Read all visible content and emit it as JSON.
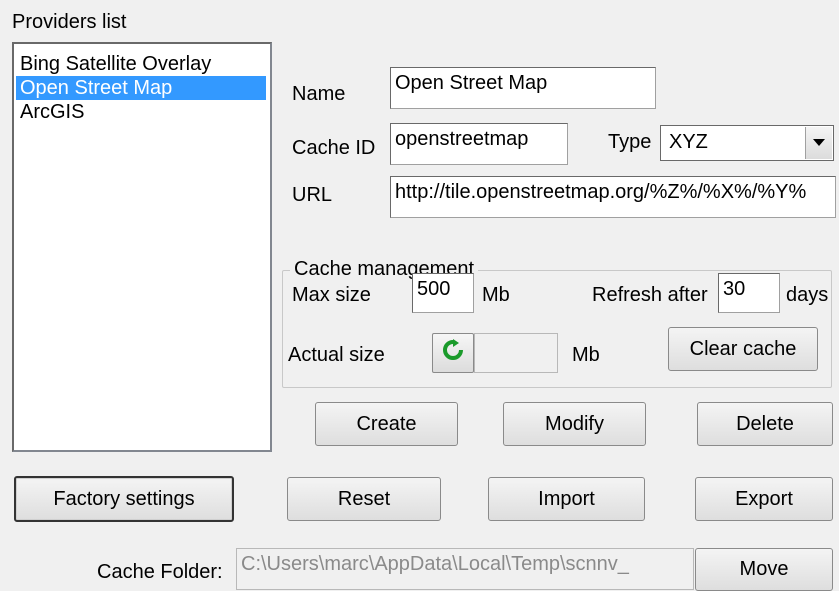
{
  "providers_list_label": "Providers list",
  "providers": [
    {
      "label": "Bing Satellite Overlay",
      "selected": false
    },
    {
      "label": "Open Street Map",
      "selected": true
    },
    {
      "label": "ArcGIS",
      "selected": false
    }
  ],
  "form": {
    "name_label": "Name",
    "name_value": "Open Street Map",
    "cache_id_label": "Cache ID",
    "cache_id_value": "openstreetmap",
    "type_label": "Type",
    "type_value": "XYZ",
    "url_label": "URL",
    "url_value": "http://tile.openstreetmap.org/%Z%/%X%/%Y%"
  },
  "cache_management": {
    "title": "Cache management",
    "max_size_label": "Max size",
    "max_size_value": "500",
    "max_size_unit": "Mb",
    "refresh_after_label": "Refresh after",
    "refresh_after_value": "30",
    "refresh_after_unit": "days",
    "actual_size_label": "Actual size",
    "actual_size_value": "",
    "actual_size_unit": "Mb",
    "clear_cache_label": "Clear cache",
    "refresh_icon": "refresh-icon",
    "refresh_icon_color": "#1a9a2a"
  },
  "actions": {
    "create_label": "Create",
    "modify_label": "Modify",
    "delete_label": "Delete"
  },
  "bottom": {
    "factory_settings_label": "Factory settings",
    "reset_label": "Reset",
    "import_label": "Import",
    "export_label": "Export",
    "cache_folder_label": "Cache Folder:",
    "cache_folder_value": "C:\\Users\\marc\\AppData\\Local\\Temp\\scnnv_",
    "move_label": "Move"
  },
  "colors": {
    "selection": "#3399ff",
    "window_bg": "#f0f0f0"
  }
}
